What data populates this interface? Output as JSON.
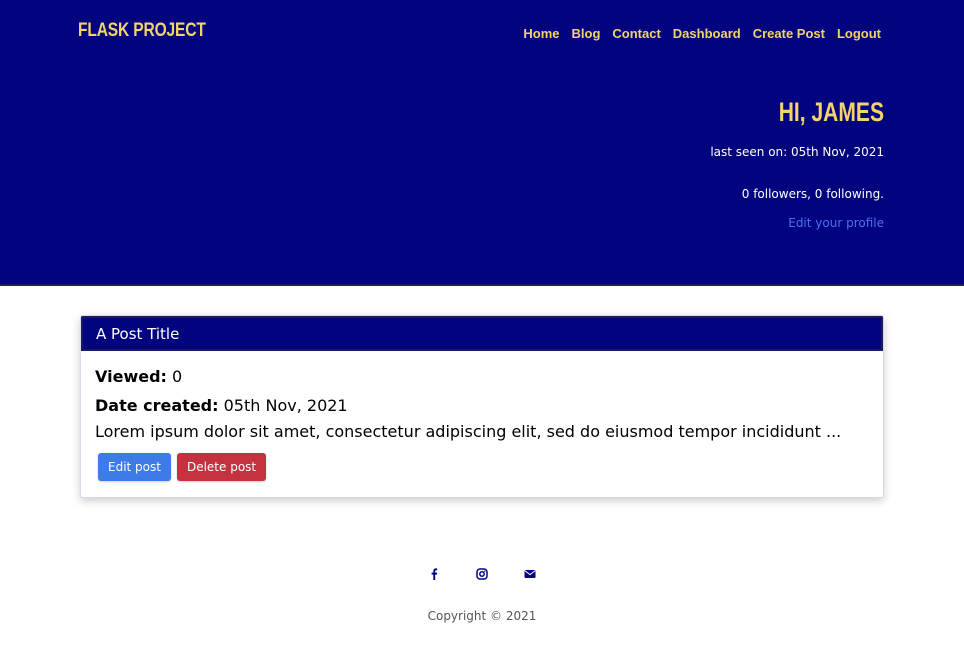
{
  "header": {
    "brand": "FLASK PROJECT",
    "nav": [
      "Home",
      "Blog",
      "Contact",
      "Dashboard",
      "Create Post",
      "Logout"
    ]
  },
  "profile": {
    "greeting": "HI, JAMES",
    "last_seen": "last seen on: 05th Nov, 2021",
    "follow_stats": "0 followers, 0 following.",
    "edit_profile": "Edit your profile"
  },
  "post": {
    "title": "A Post Title",
    "viewed_label": "Viewed:",
    "viewed_value": "0",
    "date_label": "Date created:",
    "date_value": "05th Nov, 2021",
    "excerpt": "Lorem ipsum dolor sit amet, consectetur adipiscing elit, sed do eiusmod tempor incididunt ...",
    "edit_label": "Edit post",
    "delete_label": "Delete post"
  },
  "footer": {
    "social_icons": [
      "facebook-icon",
      "instagram-icon",
      "envelope-icon"
    ],
    "copyright": "Copyright © 2021"
  },
  "colors": {
    "hero_bg": "#02037f",
    "accent_yellow": "#f3d36b",
    "link_blue": "#4d70f0",
    "edit_btn": "#3d7be9",
    "delete_btn": "#c4323f"
  }
}
